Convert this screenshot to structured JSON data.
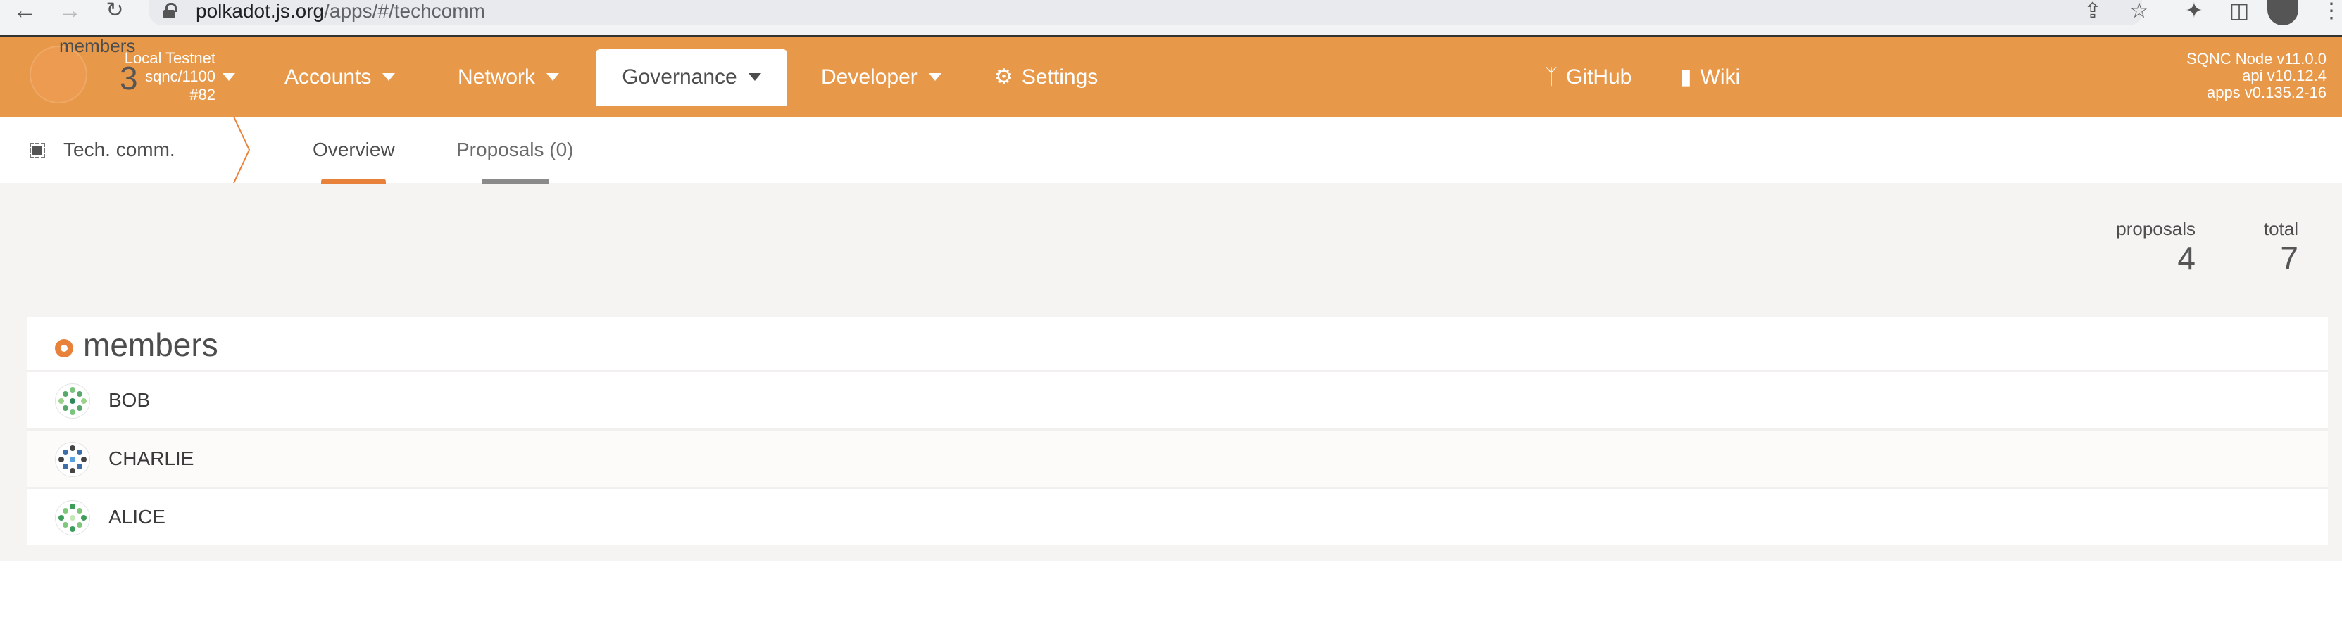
{
  "browser": {
    "url_domain": "polkadot.js.org",
    "url_path": "/apps/#/techcomm",
    "icons": [
      "back-arrow-icon",
      "forward-arrow-icon",
      "reload-icon",
      "lock-icon",
      "share-icon",
      "star-icon",
      "puzzle-icon",
      "sidepanel-icon",
      "profile-icon",
      "kebab-menu-icon"
    ]
  },
  "header": {
    "chain": {
      "name": "Local Testnet",
      "runtime": "sqnc/1100",
      "block": "#82"
    },
    "menu": [
      {
        "label": "Accounts",
        "dropdown": true
      },
      {
        "label": "Network",
        "dropdown": true
      },
      {
        "label": "Governance",
        "dropdown": true,
        "active": true
      },
      {
        "label": "Developer",
        "dropdown": true
      },
      {
        "label": "Settings",
        "icon": "gears-icon"
      }
    ],
    "links": [
      {
        "label": "GitHub",
        "icon": "code-branch-icon"
      },
      {
        "label": "Wiki",
        "icon": "book-icon"
      }
    ],
    "versions": {
      "node": "SQNC Node v11.0.0",
      "api": "api v10.12.4",
      "apps": "apps v0.135.2-16"
    },
    "accent_color": "#e89849"
  },
  "subnav": {
    "section": "Tech. comm.",
    "section_icon": "chip-icon",
    "tabs": [
      {
        "label": "Overview",
        "active": true
      },
      {
        "label": "Proposals (0)",
        "active": false
      }
    ]
  },
  "summary": {
    "members": {
      "label": "members",
      "value": "3"
    },
    "proposals": {
      "label": "proposals",
      "value": "4"
    },
    "total": {
      "label": "total",
      "value": "7"
    }
  },
  "members_table": {
    "title": "members",
    "rows": [
      {
        "name": "BOB"
      },
      {
        "name": "CHARLIE"
      },
      {
        "name": "ALICE"
      }
    ]
  }
}
